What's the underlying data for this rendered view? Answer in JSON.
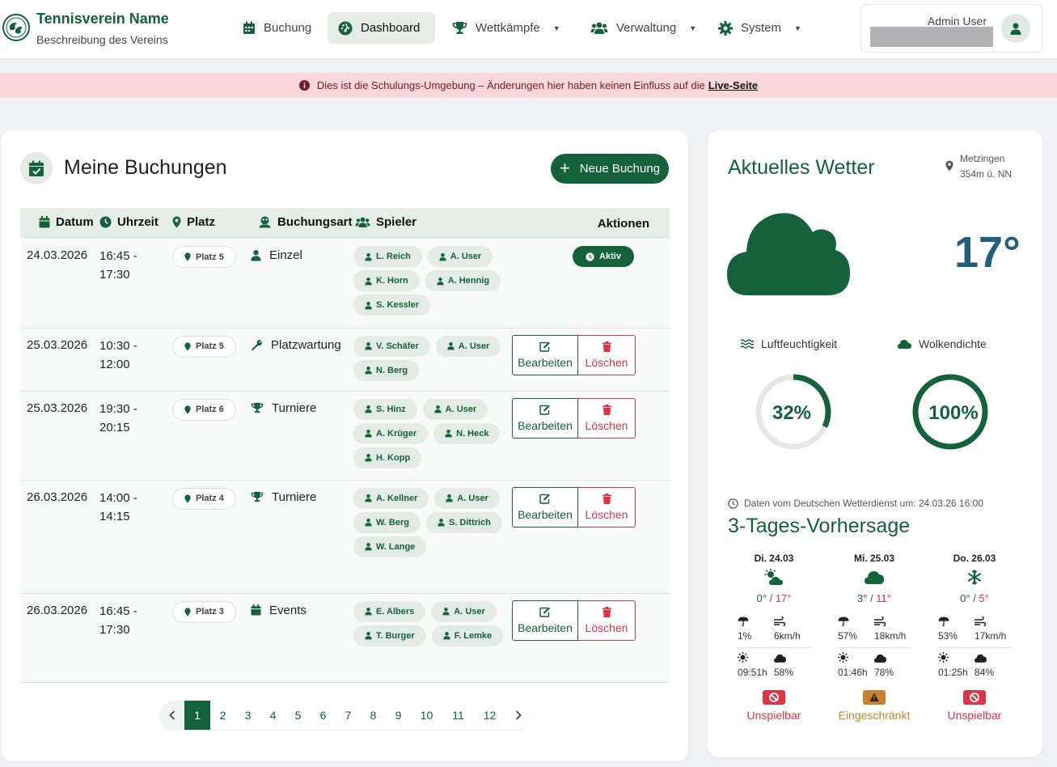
{
  "header": {
    "club_name": "Tennisverein Name",
    "club_description": "Beschreibung des Vereins",
    "nav": [
      {
        "label": "Buchung",
        "icon": "calendar-icon"
      },
      {
        "label": "Dashboard",
        "icon": "gauge-icon"
      },
      {
        "label": "Wettkämpfe",
        "icon": "trophy-icon"
      },
      {
        "label": "Verwaltung",
        "icon": "users-icon"
      },
      {
        "label": "System",
        "icon": "gear-icon"
      }
    ],
    "user": {
      "name": "Admin User"
    }
  },
  "banner": {
    "text": "Dies ist die Schulungs-Umgebung – Änderungen hier haben keinen Einfluss auf die",
    "link": "Live-Seite"
  },
  "bookings": {
    "title": "Meine Buchungen",
    "new_button": "Neue Buchung",
    "columns": [
      "Datum",
      "Uhrzeit",
      "Platz",
      "Buchungsart",
      "Spieler",
      "Aktionen"
    ],
    "rows": [
      {
        "date": "24.03.2026",
        "time_start": "16:45 -",
        "time_end": "17:30",
        "court": "Platz 5",
        "type": "Einzel",
        "type_icon": "user-icon",
        "players": [
          "L. Reich",
          "A. User",
          "K. Horn",
          "A. Hennig",
          "S. Kessler"
        ],
        "status": "Aktiv"
      },
      {
        "date": "25.03.2026",
        "time_start": "10:30 -",
        "time_end": "12:00",
        "court": "Platz 5",
        "type": "Platzwartung",
        "type_icon": "wrench-icon",
        "players": [
          "V. Schäfer",
          "A. User",
          "N. Berg"
        ]
      },
      {
        "date": "25.03.2026",
        "time_start": "19:30 -",
        "time_end": "20:15",
        "court": "Platz 6",
        "type": "Turniere",
        "type_icon": "trophy-icon",
        "players": [
          "S. Hinz",
          "A. User",
          "A. Krüger",
          "N. Heck",
          "H. Kopp"
        ]
      },
      {
        "date": "26.03.2026",
        "time_start": "14:00 -",
        "time_end": "14:15",
        "court": "Platz 4",
        "type": "Turniere",
        "type_icon": "trophy-icon",
        "players": [
          "A. Kellner",
          "A. User",
          "W. Berg",
          "S. Dittrich",
          "W. Lange"
        ]
      },
      {
        "date": "26.03.2026",
        "time_start": "16:45 -",
        "time_end": "17:30",
        "court": "Platz 3",
        "type": "Events",
        "type_icon": "calendar-icon",
        "players": [
          "E. Albers",
          "A. User",
          "T. Burger",
          "F. Lemke"
        ]
      }
    ],
    "edit_label": "Bearbeiten",
    "delete_label": "Löschen",
    "pagination": {
      "pages": [
        "1",
        "2",
        "3",
        "4",
        "5",
        "6",
        "7",
        "8",
        "9",
        "10",
        "11",
        "12"
      ],
      "current": "1"
    }
  },
  "weather": {
    "title": "Aktuelles Wetter",
    "location": "Metzingen",
    "altitude": "354m ü. NN",
    "temperature": "17°",
    "humidity_label": "Luftfeuchtigkeit",
    "humidity": "32%",
    "humidity_value": 32,
    "cloud_label": "Wolkendichte",
    "cloud": "100%",
    "cloud_value": 100,
    "source": "Daten vom Deutschen Wetterdienst um: 24.03.26 16:00",
    "forecast_title": "3-Tages-Vorhersage",
    "forecast": [
      {
        "day": "Di. 24.03",
        "icon": "cloud-sun-icon",
        "low": "0°",
        "high": "17°",
        "rain": "1%",
        "wind": "6km/h",
        "sun": "09:51h",
        "clouds": "58%",
        "status": "Unspielbar",
        "status_kind": "bad"
      },
      {
        "day": "Mi. 25.03",
        "icon": "cloud-icon",
        "low": "3°",
        "high": "11°",
        "rain": "57%",
        "wind": "18km/h",
        "sun": "01:46h",
        "clouds": "78%",
        "status": "Eingeschränkt",
        "status_kind": "warn"
      },
      {
        "day": "Do. 26.03",
        "icon": "snowflake-icon",
        "low": "0°",
        "high": "5°",
        "rain": "53%",
        "wind": "17km/h",
        "sun": "01:25h",
        "clouds": "84%",
        "status": "Unspielbar",
        "status_kind": "bad"
      }
    ]
  },
  "colors": {
    "primary": "#14613a",
    "danger": "#dc3545",
    "warning": "#c9802a",
    "temp": "#235f7b"
  }
}
